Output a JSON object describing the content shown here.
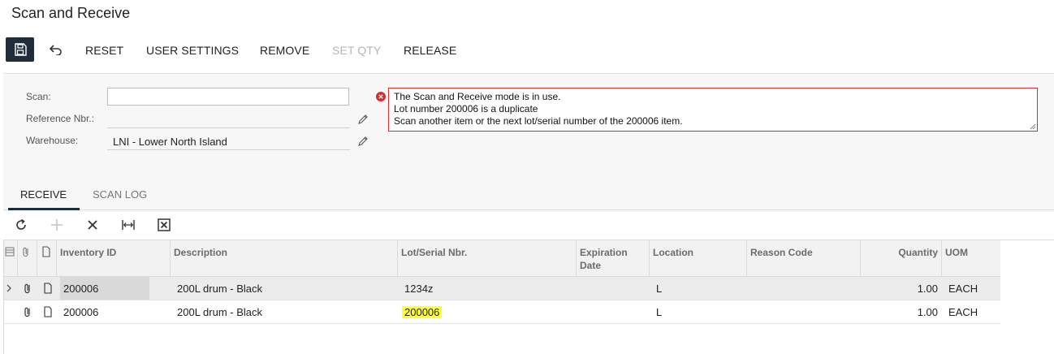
{
  "page": {
    "title": "Scan and Receive"
  },
  "toolbar": {
    "save_icon": "save-icon",
    "undo_icon": "undo-icon",
    "reset_label": "RESET",
    "user_settings_label": "USER SETTINGS",
    "remove_label": "REMOVE",
    "set_qty_label": "SET QTY",
    "release_label": "RELEASE"
  },
  "form": {
    "scan_label": "Scan:",
    "scan_value": "",
    "reference_label": "Reference Nbr.:",
    "reference_value": "",
    "warehouse_label": "Warehouse:",
    "warehouse_value": "LNI - Lower North Island"
  },
  "message": {
    "line1": "The Scan and Receive mode is in use.",
    "line2": "Lot number 200006 is a duplicate",
    "line3": "Scan another item or the next lot/serial number of the 200006 item."
  },
  "tabs": [
    {
      "label": "RECEIVE",
      "active": true
    },
    {
      "label": "SCAN LOG",
      "active": false
    }
  ],
  "grid": {
    "columns": {
      "inventory_id": "Inventory ID",
      "description": "Description",
      "lot_serial": "Lot/Serial Nbr.",
      "expiration_1": "Expiration",
      "expiration_2": "Date",
      "location": "Location",
      "reason_code": "Reason Code",
      "quantity": "Quantity",
      "uom": "UOM"
    },
    "rows": [
      {
        "inventory_id": "200006",
        "description": "200L drum - Black",
        "lot_serial": "1234z",
        "expiration": "",
        "location": "L",
        "reason_code": "",
        "quantity": "1.00",
        "uom": "EACH"
      },
      {
        "inventory_id": "200006",
        "description": "200L drum - Black",
        "lot_serial": "200006",
        "expiration": "",
        "location": "L",
        "reason_code": "",
        "quantity": "1.00",
        "uom": "EACH"
      }
    ]
  },
  "colors": {
    "error": "#d32f2f",
    "highlight": "#ffff33",
    "dark": "#1f2d3a"
  }
}
